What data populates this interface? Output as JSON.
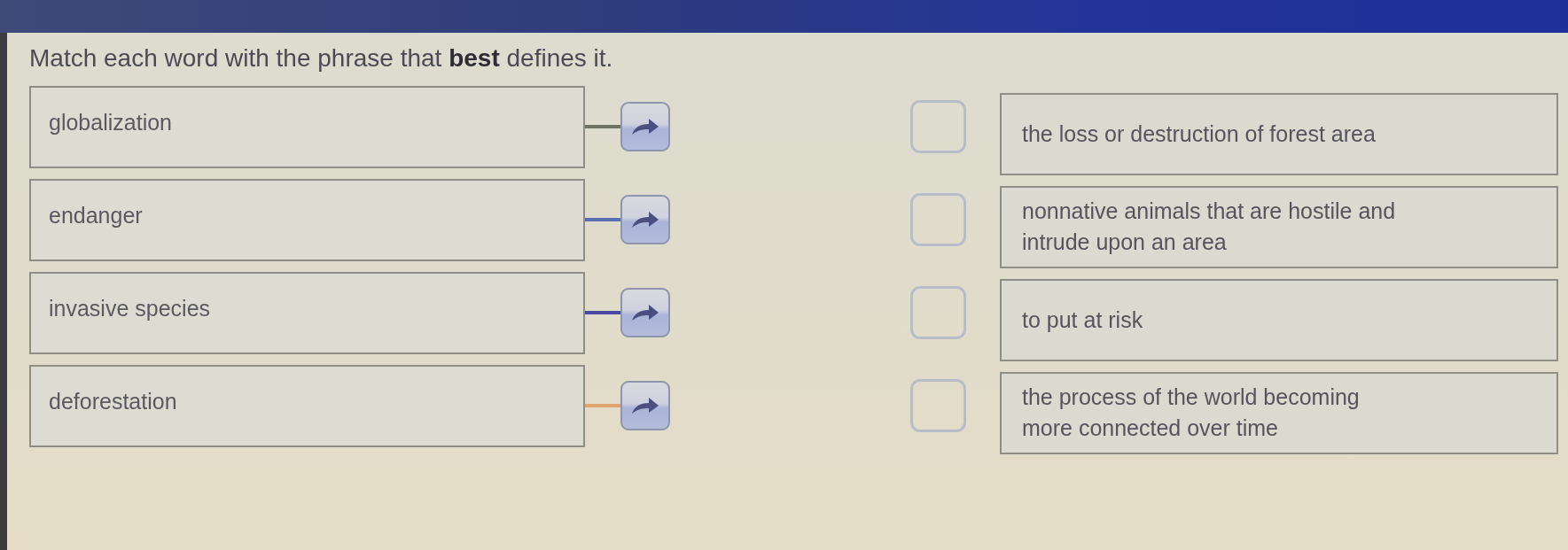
{
  "instruction": "Match each word with the phrase that **best** defines it.",
  "words": [
    {
      "text": "globalization",
      "color": "#6d7361"
    },
    {
      "text": "endanger",
      "color": "#5a6db0"
    },
    {
      "text": "invasive species",
      "color": "#4a48a0"
    },
    {
      "text": "deforestation",
      "color": "#e0a46e"
    }
  ],
  "definitions": [
    {
      "text": "the loss or destruction of forest area"
    },
    {
      "text": "nonnative animals that are hostile and\nintrude upon an area"
    },
    {
      "text": "to put at risk"
    },
    {
      "text": "the process of the world becoming\nmore connected over time"
    }
  ]
}
